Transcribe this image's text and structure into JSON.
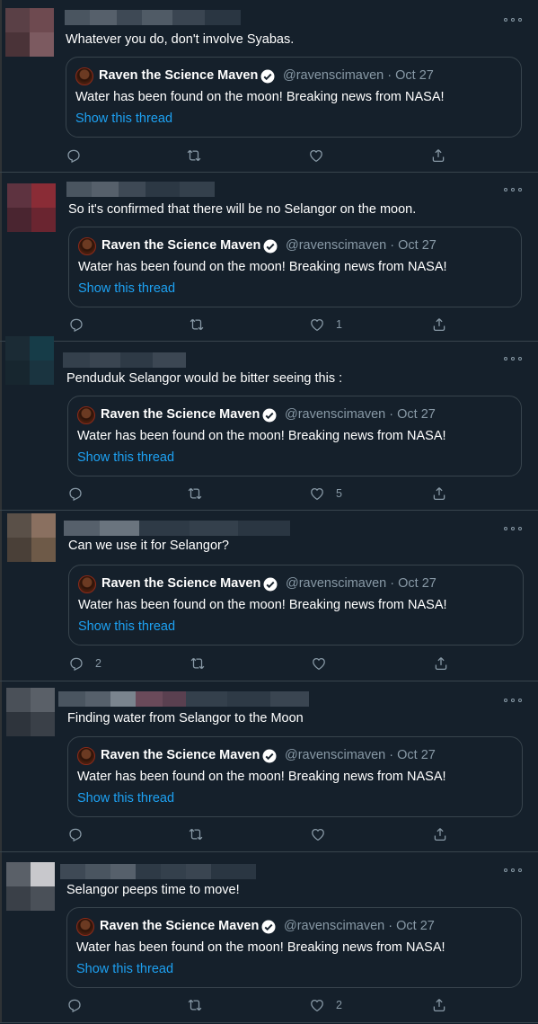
{
  "quoted": {
    "name": "Raven the Science Maven",
    "handle_date": "@ravenscimaven · Oct 27",
    "text": "Water has been found on the moon! Breaking news from NASA!",
    "show_thread": "Show this thread"
  },
  "tweets": [
    {
      "text": "Whatever you do, don't involve Syabas.",
      "reply_count": "",
      "like_count": ""
    },
    {
      "text": "So it's confirmed that there will be no Selangor on the moon.",
      "reply_count": "",
      "like_count": "1"
    },
    {
      "text": "Penduduk Selangor would be bitter seeing this :",
      "reply_count": "",
      "like_count": "5"
    },
    {
      "text": "Can we use it for Selangor?",
      "reply_count": "2",
      "like_count": ""
    },
    {
      "text": "Finding water from Selangor to the Moon",
      "reply_count": "",
      "like_count": ""
    },
    {
      "text": "Selangor peeps time to move!",
      "reply_count": "",
      "like_count": "2"
    }
  ],
  "icons": {
    "reply": "reply-icon",
    "retweet": "retweet-icon",
    "like": "like-icon",
    "share": "share-icon",
    "more": "more-icon",
    "verified": "verified-icon"
  },
  "colors": {
    "background": "#15202b",
    "border": "#38444d",
    "secondary_text": "#8899a6",
    "link": "#1da1f2"
  }
}
